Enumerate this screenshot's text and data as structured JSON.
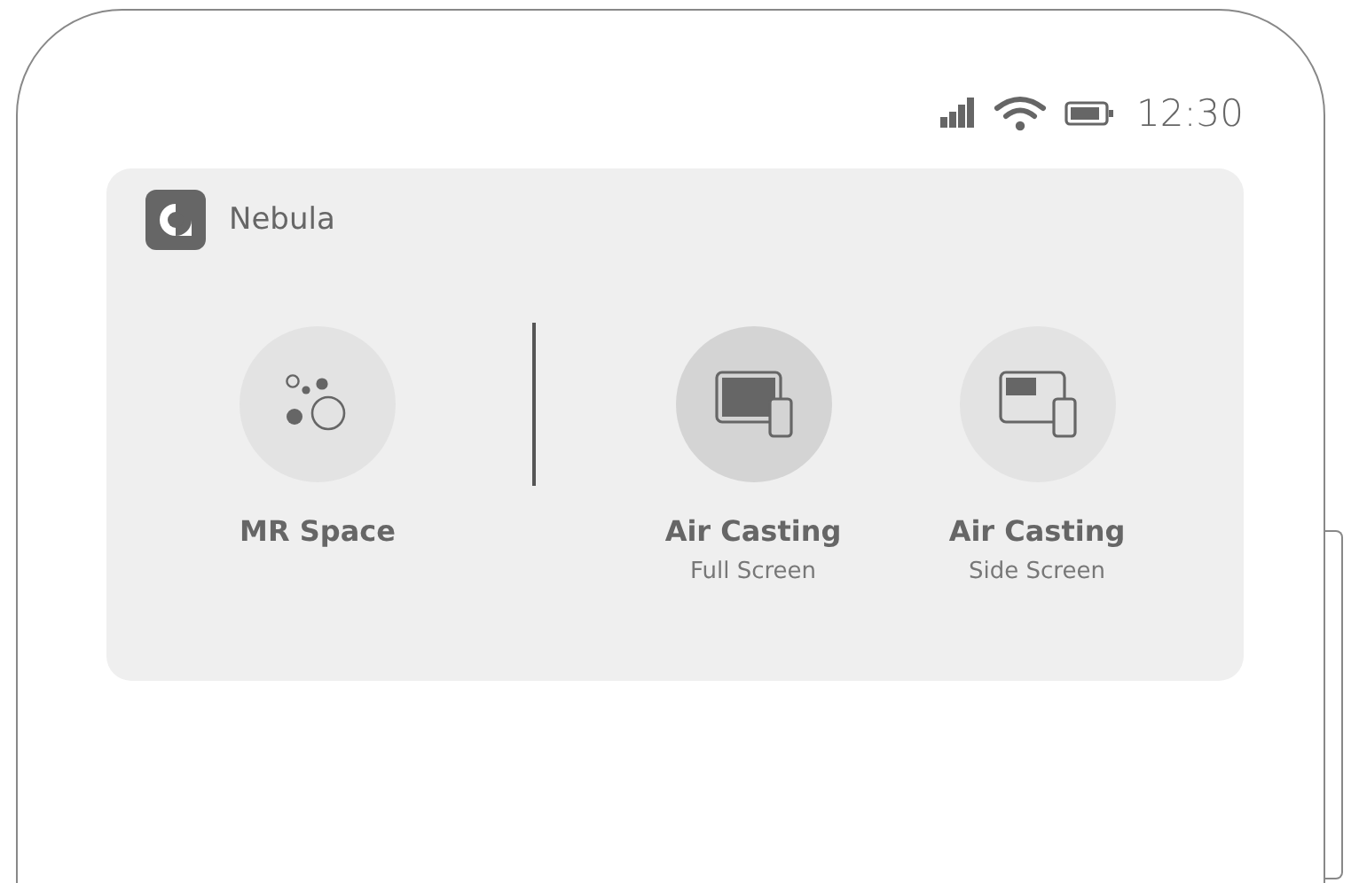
{
  "status_bar": {
    "time": "12:30"
  },
  "card": {
    "app_name": "Nebula",
    "groups": [
      [
        {
          "kind": "bubbles",
          "title": "MR Space",
          "selected": false
        }
      ],
      [
        {
          "kind": "full-screen",
          "title": "Air Casting",
          "subtitle": "Full Screen",
          "selected": true
        },
        {
          "kind": "side-screen",
          "title": "Air Casting",
          "subtitle": "Side Screen",
          "selected": false
        }
      ]
    ]
  }
}
